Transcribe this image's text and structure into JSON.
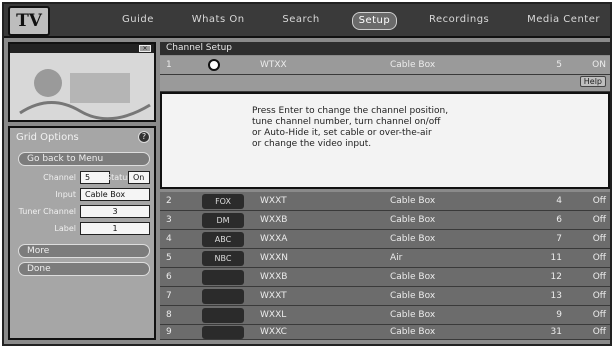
{
  "app": {
    "logo": "TV"
  },
  "tabs": [
    {
      "label": "Guide"
    },
    {
      "label": "Whats On"
    },
    {
      "label": "Search"
    },
    {
      "label": "Setup",
      "active": true
    },
    {
      "label": "Recordings"
    },
    {
      "label": "Media Center"
    }
  ],
  "left": {
    "preview_button": "×",
    "panel_title": "Grid Options",
    "panel_icon": "?",
    "go_back": "Go back to Menu",
    "fields": {
      "channel_label": "Channel",
      "channel_value": "5",
      "status_label": "Status",
      "status_value": "On",
      "input_label": "Input",
      "input_value": "Cable Box",
      "tuner_label": "Tuner Channel",
      "tuner_value": "3",
      "label_label": "Label",
      "label_value": "1"
    },
    "more_button": "More",
    "done_button": "Done"
  },
  "main": {
    "header": "Channel Setup",
    "help_badge": "Help",
    "info_lines": [
      "Press Enter to change the channel position,",
      "tune channel number, turn channel on/off",
      "or Auto-Hide it, set cable or over-the-air",
      "or change the video input."
    ],
    "selected_row": {
      "num": "1",
      "logo": "",
      "name": "WTXX",
      "source": "Cable Box",
      "channel": "5",
      "status": "ON"
    },
    "rows": [
      {
        "num": "2",
        "logo": "FOX",
        "name": "WXXT",
        "source": "Cable Box",
        "channel": "4",
        "status": "Off"
      },
      {
        "num": "3",
        "logo": "DM",
        "name": "WXXB",
        "source": "Cable Box",
        "channel": "6",
        "status": "Off"
      },
      {
        "num": "4",
        "logo": "ABC",
        "name": "WXXA",
        "source": "Cable Box",
        "channel": "7",
        "status": "Off"
      },
      {
        "num": "5",
        "logo": "NBC",
        "name": "WXXN",
        "source": "Air",
        "channel": "11",
        "status": "Off"
      },
      {
        "num": "6",
        "logo": "",
        "name": "WXXB",
        "source": "Cable Box",
        "channel": "12",
        "status": "Off"
      },
      {
        "num": "7",
        "logo": "",
        "name": "WXXT",
        "source": "Cable Box",
        "channel": "13",
        "status": "Off"
      },
      {
        "num": "8",
        "logo": "",
        "name": "WXXL",
        "source": "Cable Box",
        "channel": "9",
        "status": "Off"
      },
      {
        "num": "9",
        "logo": "",
        "name": "WXXC",
        "source": "Cable Box",
        "channel": "31",
        "status": "Off"
      }
    ]
  },
  "colors": {
    "background": "#8a8a8a",
    "selected_row": "#9a9a9a",
    "row": "#6c6c6c"
  }
}
